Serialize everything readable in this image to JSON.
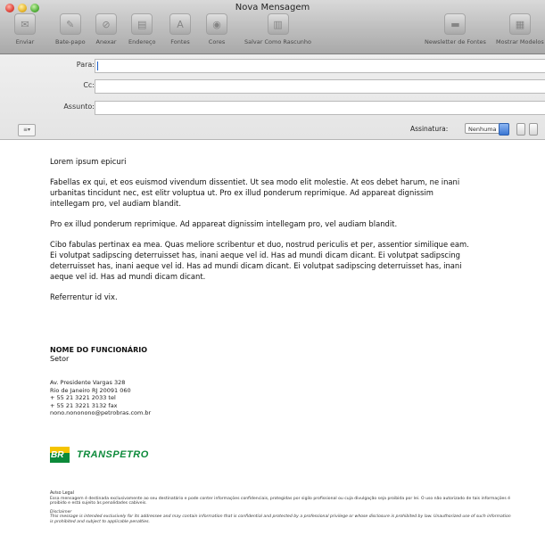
{
  "window": {
    "title": "Nova Mensagem"
  },
  "toolbar": {
    "buttons": [
      {
        "label": "Enviar"
      },
      {
        "label": "Bate-papo"
      },
      {
        "label": "Anexar"
      },
      {
        "label": "Endereço"
      },
      {
        "label": "Fontes"
      },
      {
        "label": "Cores"
      },
      {
        "label": "Salvar Como Rascunho"
      },
      {
        "label": "Newsletter de Fontes"
      },
      {
        "label": "Mostrar Modelos"
      }
    ]
  },
  "fields": {
    "to_label": "Para:",
    "cc_label": "Cc:",
    "subject_label": "Assunto:",
    "to_value": "",
    "cc_value": "",
    "subject_value": ""
  },
  "signature_bar": {
    "label": "Assinatura:",
    "selected": "Nenhuma"
  },
  "message": {
    "paragraphs": [
      "Lorem ipsum epicuri",
      "Fabellas ex qui, et eos euismod vivendum dissentiet. Ut sea modo elit molestie. At eos debet harum, ne inani urbanitas tincidunt nec, est elitr voluptua ut. Pro ex illud ponderum reprimique. Ad appareat dignissim intellegam pro, vel audiam blandit.",
      "Pro ex illud ponderum reprimique. Ad appareat dignissim intellegam pro, vel audiam blandit.",
      "Cibo fabulas pertinax ea mea. Quas meliore scribentur et duo, nostrud periculis et per, assentior similique eam. Ei volutpat sadipscing deterruisset has, inani aeque vel id. Has ad mundi dicam dicant. Ei volutpat sadipscing deterruisset has, inani aeque vel id. Has ad mundi dicam dicant. Ei volutpat sadipscing deterruisset has, inani aeque vel id. Has ad mundi dicam dicant.",
      "Referrentur id vix."
    ]
  },
  "signature": {
    "name": "NOME DO FUNCIONÁRIO",
    "department": "Setor",
    "address_lines": [
      "Av. Presidente Vargas 328",
      "Rio de Janeiro  RJ  20091 060",
      "+ 55  21  3221  2033  tel",
      "+ 55  21  3221  3132  fax",
      "nono.nononono@petrobras.com.br"
    ],
    "logo_badge": "BR",
    "logo_text": "TRANSPETRO",
    "colors": {
      "green": "#0c8a3a",
      "yellow": "#f5c400"
    }
  },
  "legal": {
    "title": "Aviso Legal",
    "text": "Essa mensagem é destinada exclusivamente ao seu destinatário e pode conter informações confidenciais, protegidas por sigilo profissional ou cuja divulgação seja proibida por lei. O uso não autorizado de tais informações é proibido e está sujeito às penalidades cabíveis.",
    "disclaimer_title": "Disclaimer",
    "disclaimer_text": "This message is intended exclusively for its addressee and may contain information that is confidential and protected by a professional privilege or whose disclosure is prohibited by law. Unauthorized use of such information is prohibited and subject to applicable penalties."
  }
}
